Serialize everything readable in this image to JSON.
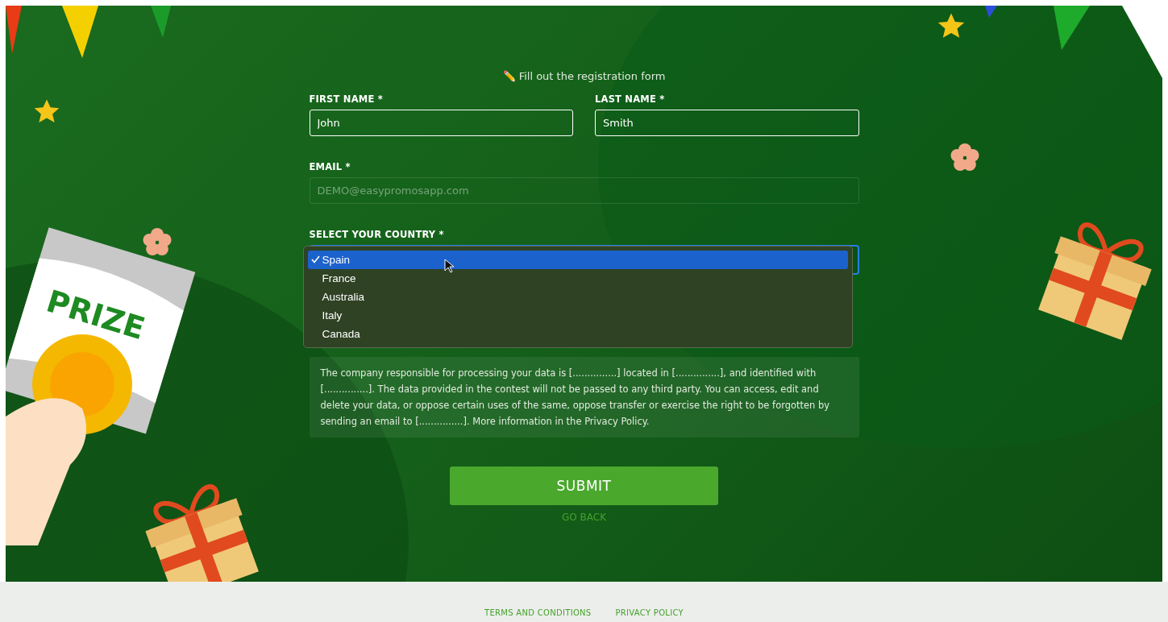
{
  "prize_card_text": "PRIZE",
  "heading": "✏️ Fill out the registration form",
  "name_fields": [
    {
      "label": "FIRST NAME *",
      "value": "John"
    },
    {
      "label": "LAST NAME *",
      "value": "Smith"
    }
  ],
  "email_field": {
    "label": "EMAIL *",
    "placeholder": "DEMO@easypromosapp.com"
  },
  "country_select": {
    "label": "SELECT YOUR COUNTRY *",
    "expanded": true,
    "options": [
      {
        "label": "Spain",
        "selected": true
      },
      {
        "label": "France",
        "selected": false
      },
      {
        "label": "Australia",
        "selected": false
      },
      {
        "label": "Italy",
        "selected": false
      },
      {
        "label": "Canada",
        "selected": false
      }
    ]
  },
  "privacy_notice": "The company responsible for processing your data is [...............] located in [...............], and identified with [...............]. The data provided in the contest will not be passed to any third party. You can access, edit and delete your data, or oppose certain uses of the same, oppose transfer or exercise the right to be forgotten by sending an email to [...............]. More information in the Privacy Policy.",
  "submit_button": "SUBMIT",
  "go_back_link": "GO BACK",
  "footer_links": [
    "TERMS AND CONDITIONS",
    "PRIVACY POLICY"
  ]
}
